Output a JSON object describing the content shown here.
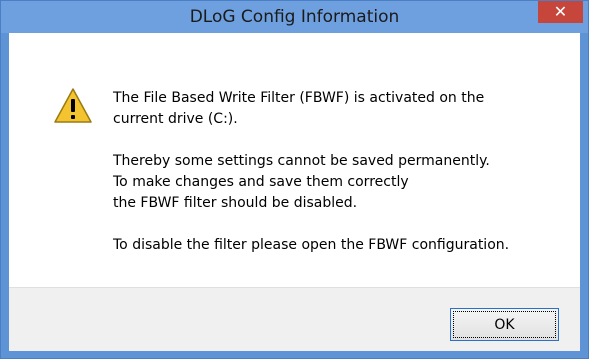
{
  "window": {
    "title": "DLoG Config Information",
    "close_glyph": "✕"
  },
  "icon": {
    "type": "warning-icon",
    "color": "#f4c430"
  },
  "message": {
    "paragraphs": [
      "The File Based Write Filter (FBWF) is activated on the\ncurrent drive (C:).",
      "Thereby some settings cannot be saved permanently.\nTo make changes and save them correctly\nthe FBWF filter should be disabled.",
      "To disable the filter please open the FBWF configuration."
    ]
  },
  "buttons": {
    "ok_label": "OK"
  },
  "colors": {
    "titlebar": "#6ea0df",
    "close_button": "#c7463b",
    "footer": "#f0f0f0"
  }
}
